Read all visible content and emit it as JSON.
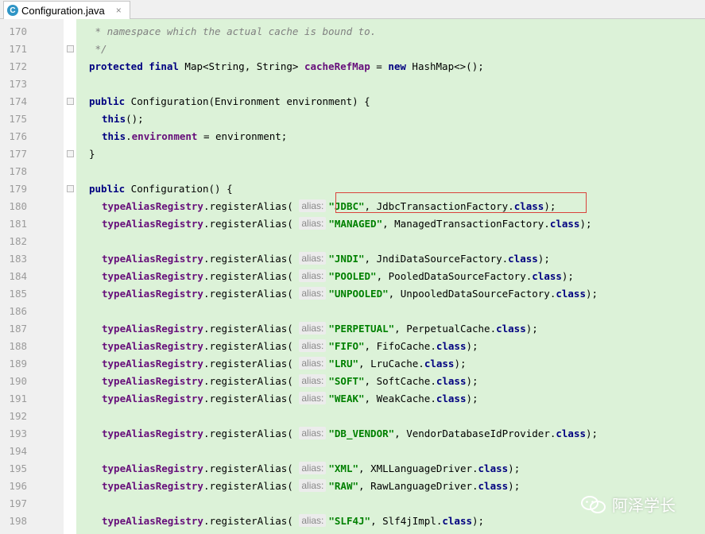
{
  "tab": {
    "title": "Configuration.java",
    "icon": "C",
    "close": "×"
  },
  "colors": {
    "code_background": "#dcf2d8",
    "keyword": "#000080",
    "field": "#660e7a",
    "string": "#008000",
    "comment": "#808080",
    "highlight_box": "#d9433b"
  },
  "hint_label": "alias:",
  "lines": [
    {
      "num": "170",
      "text": " * namespace which the actual cache is bound to."
    },
    {
      "num": "171",
      "text": " */"
    },
    {
      "num": "172",
      "text": "protected final Map<String, String> cacheRefMap = new HashMap<>();"
    },
    {
      "num": "173",
      "text": ""
    },
    {
      "num": "174",
      "text": "public Configuration(Environment environment) {"
    },
    {
      "num": "175",
      "text": "this();"
    },
    {
      "num": "176",
      "text": "this.environment = environment;"
    },
    {
      "num": "177",
      "text": "}"
    },
    {
      "num": "178",
      "text": ""
    },
    {
      "num": "179",
      "text": "public Configuration() {"
    },
    {
      "num": "180",
      "alias": "\"JDBC\"",
      "cls": "JdbcTransactionFactory"
    },
    {
      "num": "181",
      "alias": "\"MANAGED\"",
      "cls": "ManagedTransactionFactory"
    },
    {
      "num": "182",
      "text": ""
    },
    {
      "num": "183",
      "alias": "\"JNDI\"",
      "cls": "JndiDataSourceFactory"
    },
    {
      "num": "184",
      "alias": "\"POOLED\"",
      "cls": "PooledDataSourceFactory"
    },
    {
      "num": "185",
      "alias": "\"UNPOOLED\"",
      "cls": "UnpooledDataSourceFactory"
    },
    {
      "num": "186",
      "text": ""
    },
    {
      "num": "187",
      "alias": "\"PERPETUAL\"",
      "cls": "PerpetualCache"
    },
    {
      "num": "188",
      "alias": "\"FIFO\"",
      "cls": "FifoCache"
    },
    {
      "num": "189",
      "alias": "\"LRU\"",
      "cls": "LruCache"
    },
    {
      "num": "190",
      "alias": "\"SOFT\"",
      "cls": "SoftCache"
    },
    {
      "num": "191",
      "alias": "\"WEAK\"",
      "cls": "WeakCache"
    },
    {
      "num": "192",
      "text": ""
    },
    {
      "num": "193",
      "alias": "\"DB_VENDOR\"",
      "cls": "VendorDatabaseIdProvider"
    },
    {
      "num": "194",
      "text": ""
    },
    {
      "num": "195",
      "alias": "\"XML\"",
      "cls": "XMLLanguageDriver"
    },
    {
      "num": "196",
      "alias": "\"RAW\"",
      "cls": "RawLanguageDriver"
    },
    {
      "num": "197",
      "text": ""
    },
    {
      "num": "198",
      "alias": "\"SLF4J\"",
      "cls": "Slf4jImpl"
    }
  ],
  "watermark": {
    "text": "阿泽学长",
    "icon": "wechat-icon"
  }
}
